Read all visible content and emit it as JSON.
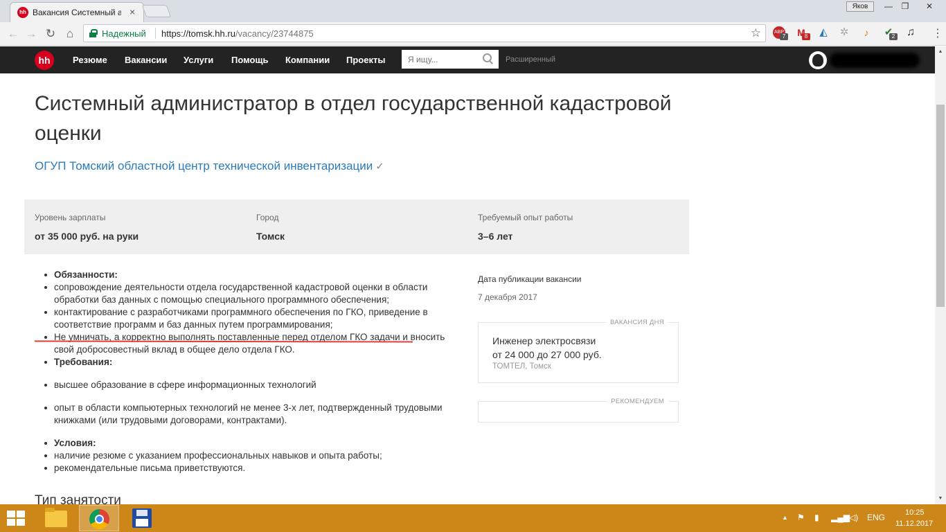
{
  "browser": {
    "tab_title": "Вакансия Системный ад",
    "tab_favicon": "hh",
    "user_badge": "Яков",
    "secure_label": "Надежный",
    "url_host": "https://tomsk.hh.ru",
    "url_path": "/vacancy/23744875",
    "extension_icons": [
      "abp-icon",
      "gmail-icon",
      "sync-icon",
      "gear-icon",
      "music-icon",
      "shield-check-icon",
      "music-note-icon"
    ],
    "extension_badges": [
      "7",
      "8",
      "2"
    ]
  },
  "site_header": {
    "logo": "hh",
    "nav": [
      "Резюме",
      "Вакансии",
      "Услуги",
      "Помощь",
      "Компании",
      "Проекты"
    ],
    "search_placeholder": "Я ищу...",
    "advanced_label": "Расширенный"
  },
  "vacancy": {
    "title": "Системный администратор в отдел государственной кадастровой оценки",
    "company": "ОГУП Томский областной центр технической инвентаризации",
    "company_verified_mark": "✓",
    "salary_label": "Уровень зарплаты",
    "salary_value": "от 35 000 руб. на руки",
    "city_label": "Город",
    "city_value": "Томск",
    "experience_label": "Требуемый опыт работы",
    "experience_value": "3–6 лет",
    "description": {
      "duties_heading": "Обязанности:",
      "duties": [
        "сопровождение деятельности отдела государственной кадастровой оценки в области обработки баз данных с помощью специального программного обеспечения;",
        "контактирование с разработчиками программного обеспечения по ГКО, приведение в соответствие программ и баз данных путем программирования;",
        "Не умничать, а корректно выполнять поставленные перед отделом ГКО задачи и вносить свой добросовестный вклад в общее дело отдела ГКО."
      ],
      "requirements_heading": "Требования:",
      "requirements": [
        "высшее образование в сфере информационных технологий",
        "опыт в области компьютерных технологий не менее 3-х лет, подтвержденный трудовыми книжками (или трудовыми договорами, контрактами)."
      ],
      "conditions_heading": "Условия:",
      "conditions": [
        "наличие резюме с указанием профессиональных навыков и опыта работы;",
        "рекомендательные письма приветствуются."
      ]
    },
    "employment_heading": "Тип занятости"
  },
  "sidebar": {
    "pub_label": "Дата публикации вакансии",
    "pub_date": "7 декабря 2017",
    "vacancy_of_day": {
      "caption": "ВАКАНСИЯ ДНЯ",
      "title": "Инженер электросвязи",
      "salary": "от 24 000 до 27 000 руб.",
      "company": "ТОМТЕЛ, Томск"
    },
    "recommended_caption": "РЕКОМЕНДУЕМ"
  },
  "taskbar": {
    "language": "ENG",
    "time": "10:25",
    "date": "11.12.2017"
  },
  "colors": {
    "hh_red": "#d6001c",
    "header_bg": "#232323",
    "link_blue": "#2b7bb9",
    "taskbar": "#cc8718",
    "annotation_red": "#e53a3a"
  }
}
